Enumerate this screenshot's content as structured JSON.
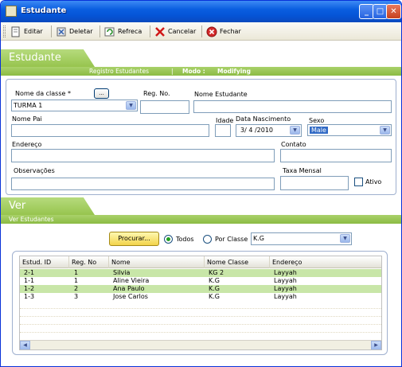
{
  "window": {
    "title": "Estudante"
  },
  "toolbar": {
    "edit": "Editar",
    "delete": "Deletar",
    "refresh": "Refreca",
    "cancel": "Cancelar",
    "close": "Fechar"
  },
  "banner1": {
    "title": "Estudante",
    "sub1": "Registro Estudantes",
    "sep": "|",
    "mode_label": "Modo :",
    "mode_value": "Modifying"
  },
  "form": {
    "class_label": "Nome da classe *",
    "class_btn": "...",
    "class_value": "TURMA 1",
    "reg_label": "Reg. No.",
    "reg_value": "",
    "name_label": "Nome Estudante",
    "name_value": "",
    "father_label": "Nome Pai",
    "father_value": "",
    "age_label": "Idade",
    "age_value": "",
    "dob_label": "Data Nascimento",
    "dob_value": "3/ 4 /2010",
    "sex_label": "Sexo",
    "sex_value": "Male",
    "address_label": "Endereço",
    "address_value": "",
    "contact_label": "Contato",
    "contact_value": "",
    "notes_label": "Observações",
    "notes_value": "",
    "fee_label": "Taxa Mensal",
    "fee_value": "",
    "active_label": "Ativo"
  },
  "banner2": {
    "title": "Ver",
    "sub1": "Ver Estudantes"
  },
  "search": {
    "button": "Procurar...",
    "all_label": "Todos",
    "byclass_label": "Por Classe",
    "class_value": "K.G"
  },
  "table": {
    "headers": [
      "Estud. ID",
      "Reg. No",
      "Nome",
      "Nome Classe",
      "Endereço"
    ],
    "rows": [
      [
        "2-1",
        "1",
        "Silvia",
        "KG 2",
        "Layyah"
      ],
      [
        "1-1",
        "1",
        "Aline Vieira",
        "K.G",
        "Layyah"
      ],
      [
        "1-2",
        "2",
        "Ana Paulo",
        "K.G",
        "Layyah"
      ],
      [
        "1-3",
        "3",
        "Jose Carlos",
        "K.G",
        "Layyah"
      ]
    ]
  }
}
